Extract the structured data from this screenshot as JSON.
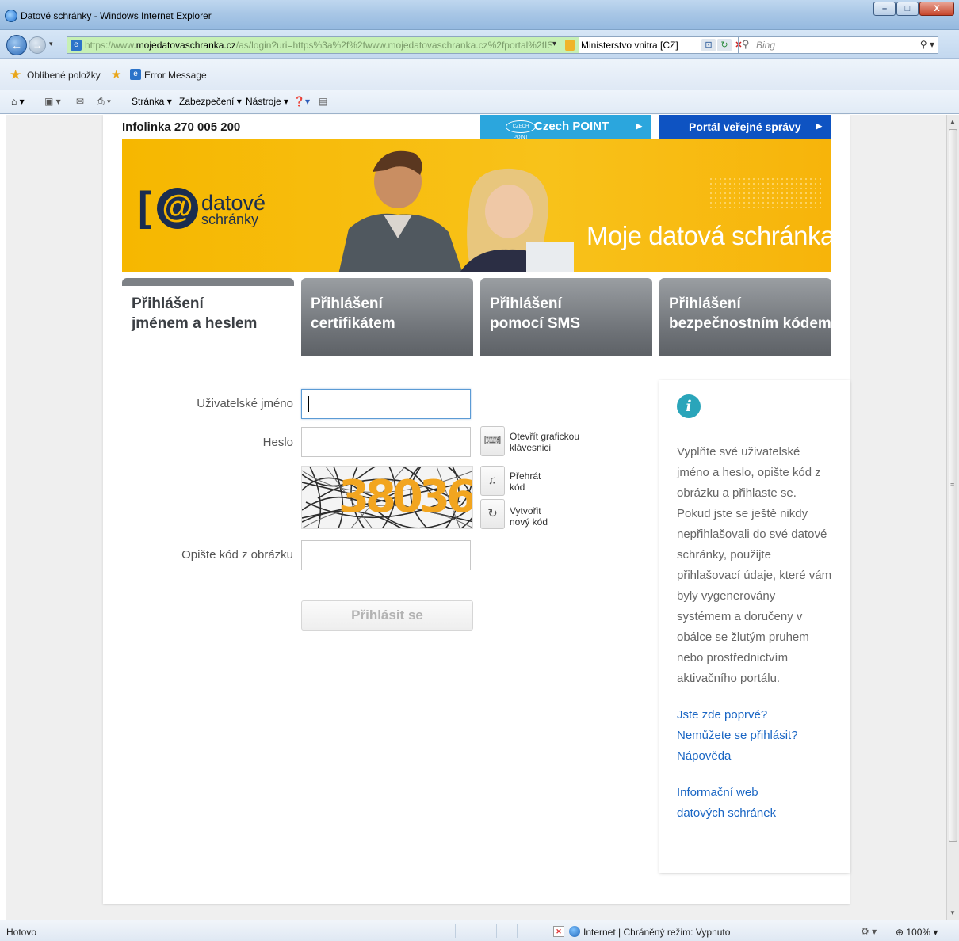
{
  "window": {
    "title": "Datové schránky - Windows Internet Explorer",
    "btn_min": "–",
    "btn_max": "□",
    "btn_close": "X"
  },
  "addressbar": {
    "url_prefix": "https://www.",
    "url_domain": "mojedatovaschranka.cz",
    "url_rest": "/as/login?uri=https%3a%2f%2fwww.mojedatovaschranka.cz%2fportal%2fISDS%",
    "cert_label": "Ministerstvo vnitra [CZ]",
    "search_placeholder": "Bing"
  },
  "favorites": {
    "label": "Oblíbené položky",
    "item": "Error Message"
  },
  "commandbar": {
    "page": "Stránka ▾",
    "security": "Zabezpečení ▾",
    "tools": "Nástroje ▾"
  },
  "header": {
    "hotline": "Infolinka 270 005 200",
    "czech_point": "Czech POINT",
    "czech_point_logo": "CZECH POINT",
    "portal": "Portál veřejné správy"
  },
  "banner": {
    "logo_line1": "datové",
    "logo_line2": "schránky",
    "slogan": "Moje datová schránka"
  },
  "tabs": [
    {
      "line1": "Přihlášení",
      "line2": "jménem a heslem",
      "active": true
    },
    {
      "line1": "Přihlášení",
      "line2": "certifikátem",
      "active": false
    },
    {
      "line1": "Přihlášení",
      "line2": "pomocí SMS",
      "active": false
    },
    {
      "line1": "Přihlášení",
      "line2": "bezpečnostním kódem",
      "active": false
    }
  ],
  "form": {
    "username_label": "Uživatelské jméno",
    "username_value": "",
    "password_label": "Heslo",
    "password_value": "",
    "keyboard_label_line1": "Otevřít grafickou",
    "keyboard_label_line2": "klávesnici",
    "play_label_line1": "Přehrát",
    "play_label_line2": "kód",
    "new_code_label_line1": "Vytvořit",
    "new_code_label_line2": "nový kód",
    "captcha_text": "38036",
    "captcha_label": "Opište kód z obrázku",
    "captcha_value": "",
    "submit_label": "Přihlásit se"
  },
  "info": {
    "icon": "i",
    "text": "Vyplňte své uživatelské jméno a heslo, opište kód z obrázku a přihlaste se. Pokud jste se ještě nikdy nepřihlašovali do své datové schránky, použijte přihlašovací údaje, které vám byly vygenerovány systémem a doručeny v obálce se žlutým pruhem nebo prostřednictvím aktivačního portálu.",
    "link1": "Jste zde poprvé?",
    "link2": "Nemůžete se přihlásit?",
    "link3": "Nápověda",
    "link4_line1": "Informační web",
    "link4_line2": "datových schránek"
  },
  "statusbar": {
    "status": "Hotovo",
    "zone": "Internet | Chráněný režim: Vypnuto",
    "zoom": "100%"
  }
}
